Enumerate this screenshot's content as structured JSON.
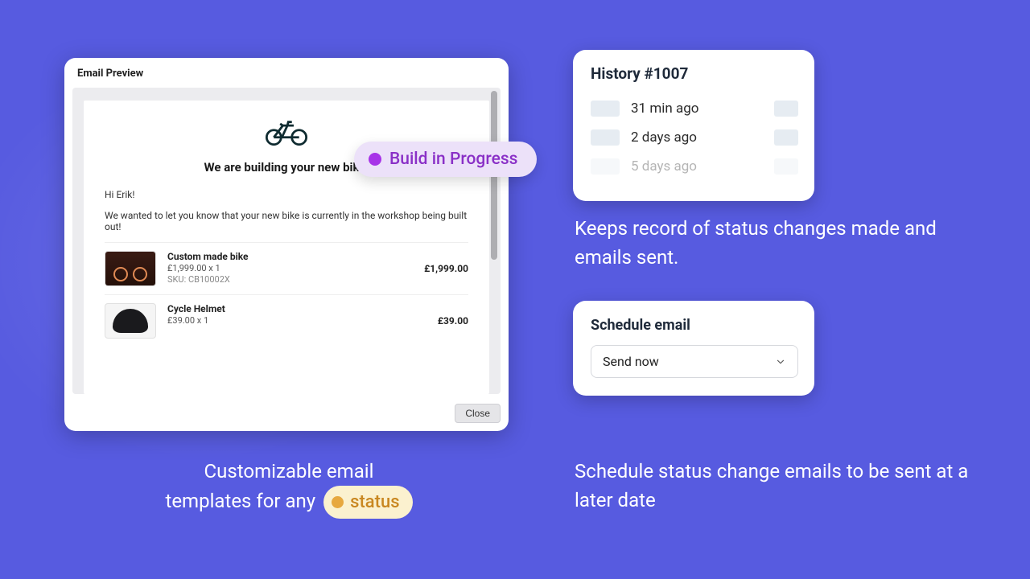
{
  "email_preview": {
    "panel_title": "Email Preview",
    "headline": "We are building your new bike!",
    "greeting": "Hi Erik!",
    "body_line": "We wanted to let you know that your new bike is currently in the workshop being built out!",
    "items": [
      {
        "name": "Custom made bike",
        "meta": "£1,999.00 x 1",
        "sku": "SKU: CB10002X",
        "price": "£1,999.00"
      },
      {
        "name": "Cycle Helmet",
        "meta": "£39.00 x 1",
        "sku": "",
        "price": "£39.00"
      }
    ],
    "close_label": "Close"
  },
  "floating_status": {
    "label": "Build in Progress",
    "dot_color": "#A733E8"
  },
  "caption_left": {
    "line1": "Customizable email",
    "line2_prefix": "templates for any",
    "chip_label": "status"
  },
  "history": {
    "title": "History #1007",
    "rows": [
      {
        "time": "31 min ago"
      },
      {
        "time": "2 days ago"
      },
      {
        "time": "5 days ago"
      }
    ]
  },
  "caption_right_1": "Keeps record of status changes made and emails sent.",
  "schedule": {
    "title": "Schedule email",
    "selected": "Send now"
  },
  "caption_right_2": "Schedule status change emails to be sent at a later date"
}
